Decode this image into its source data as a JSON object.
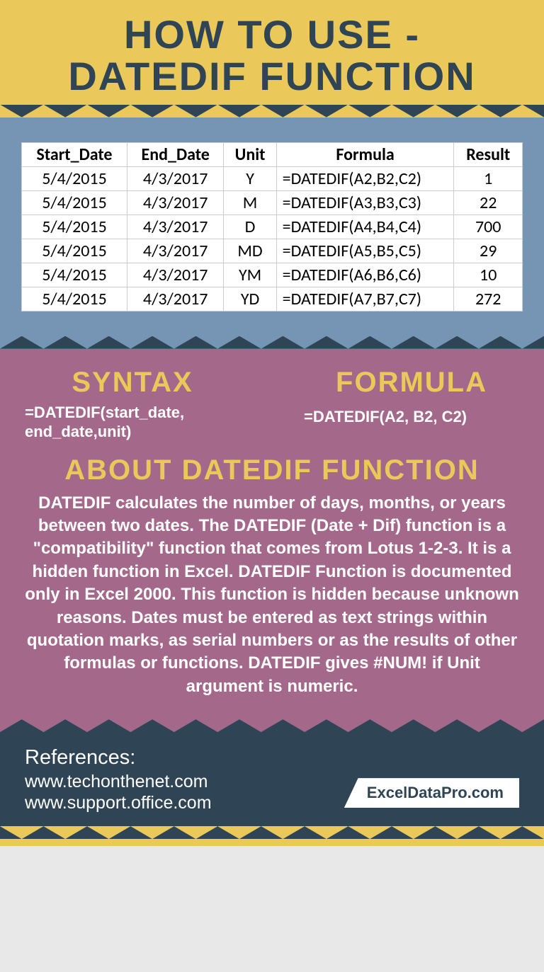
{
  "header": {
    "title_line1": "HOW TO USE -",
    "title_line2": "DATEDIF FUNCTION"
  },
  "table": {
    "headers": [
      "Start_Date",
      "End_Date",
      "Unit",
      "Formula",
      "Result"
    ],
    "rows": [
      {
        "start": "5/4/2015",
        "end": "4/3/2017",
        "unit": "Y",
        "formula": "=DATEDIF(A2,B2,C2)",
        "result": "1"
      },
      {
        "start": "5/4/2015",
        "end": "4/3/2017",
        "unit": "M",
        "formula": "=DATEDIF(A3,B3,C3)",
        "result": "22"
      },
      {
        "start": "5/4/2015",
        "end": "4/3/2017",
        "unit": "D",
        "formula": "=DATEDIF(A4,B4,C4)",
        "result": "700"
      },
      {
        "start": "5/4/2015",
        "end": "4/3/2017",
        "unit": "MD",
        "formula": "=DATEDIF(A5,B5,C5)",
        "result": "29"
      },
      {
        "start": "5/4/2015",
        "end": "4/3/2017",
        "unit": "YM",
        "formula": "=DATEDIF(A6,B6,C6)",
        "result": "10"
      },
      {
        "start": "5/4/2015",
        "end": "4/3/2017",
        "unit": "YD",
        "formula": "=DATEDIF(A7,B7,C7)",
        "result": "272"
      }
    ]
  },
  "syntax": {
    "heading": "SYNTAX",
    "text": "=DATEDIF(start_date, end_date,unit)"
  },
  "formula": {
    "heading": "FORMULA",
    "text": "=DATEDIF(A2, B2, C2)"
  },
  "about": {
    "heading": "ABOUT DATEDIF FUNCTION",
    "text": "DATEDIF calculates the number of days, months, or years between two dates. The DATEDIF (Date + Dif) function is a \"compatibility\" function that comes from Lotus 1-2-3. It is a hidden function in Excel. DATEDIF Function is documented only in Excel 2000. This function is hidden because unknown reasons. Dates must be entered as text strings within quotation marks, as serial numbers or as the results of other formulas or functions. DATEDIF gives #NUM! if Unit argument is numeric."
  },
  "footer": {
    "references_title": "References:",
    "ref1": "www.techonthenet.com",
    "ref2": "www.support.office.com",
    "brand": "ExcelDataPro.com"
  }
}
